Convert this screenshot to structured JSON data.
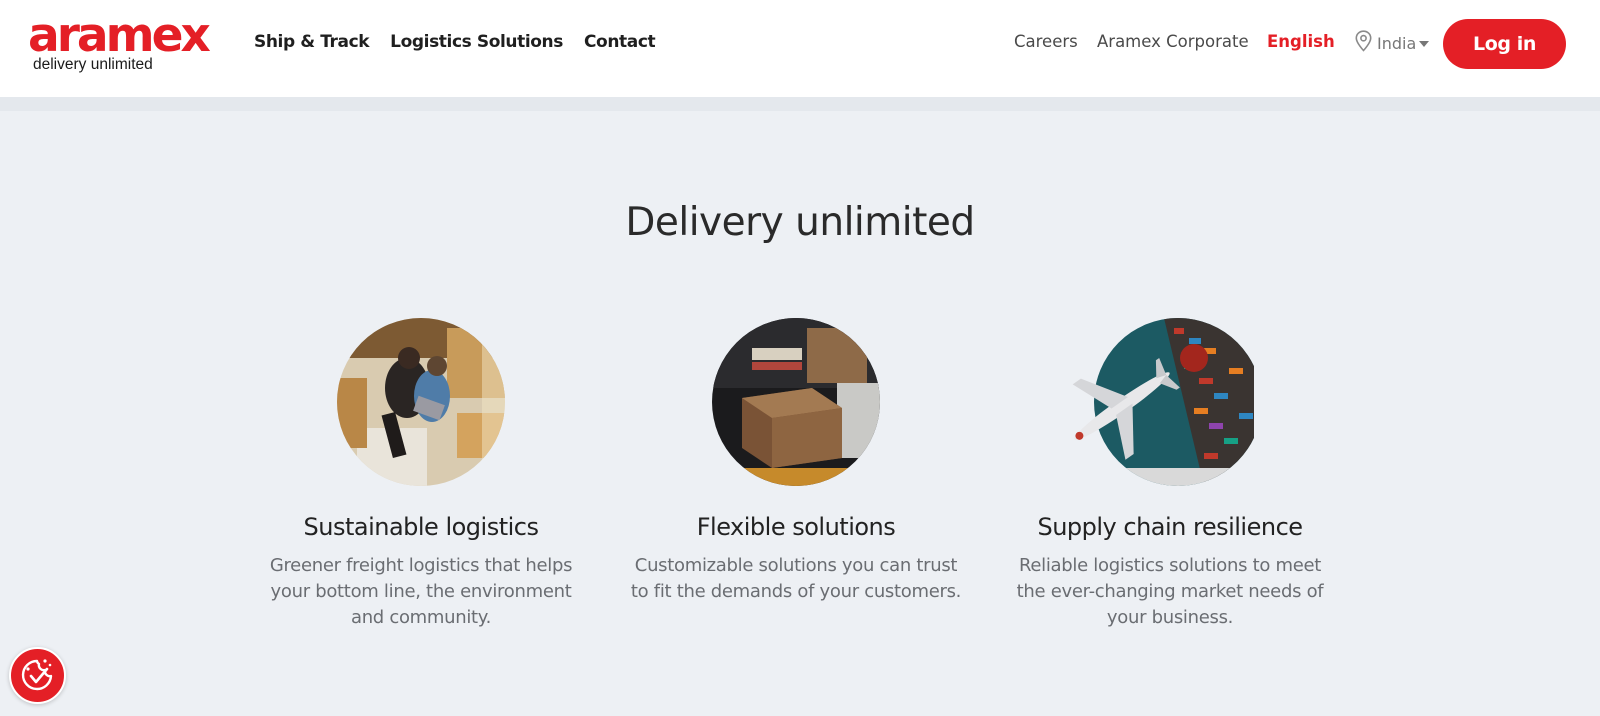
{
  "brand": {
    "logo_text": "aramex",
    "tagline": "delivery unlimited",
    "color": "#e41f26"
  },
  "nav": {
    "main": [
      "Ship & Track",
      "Logistics Solutions",
      "Contact"
    ],
    "careers": "Careers",
    "corporate": "Aramex Corporate",
    "language": "English",
    "region": "India",
    "login": "Log in"
  },
  "main": {
    "title": "Delivery unlimited",
    "features": [
      {
        "title": "Sustainable logistics",
        "text": "Greener freight logistics that helps your bottom line, the environment and community.",
        "image_icon": "people-packing-boxes-photo"
      },
      {
        "title": "Flexible solutions",
        "text": "Customizable solutions you can trust to fit the demands of your customers.",
        "image_icon": "cardboard-box-photo"
      },
      {
        "title": "Supply chain resilience",
        "text": "Reliable logistics solutions to meet the ever-changing market needs of your business.",
        "image_icon": "plane-and-container-ship-photo"
      }
    ]
  },
  "cookie": {
    "icon": "cookie-consent-icon"
  }
}
